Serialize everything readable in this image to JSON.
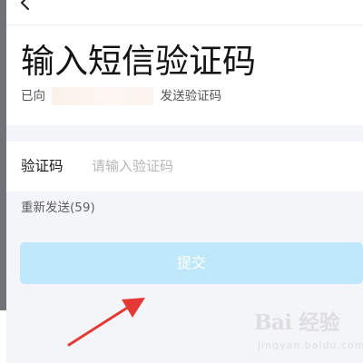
{
  "header": {
    "back_icon": "chevron-left-icon",
    "title": "输入短信验证码",
    "sent_prefix": "已向",
    "sent_suffix": "发送验证码"
  },
  "form": {
    "code_label": "验证码",
    "code_value": "",
    "code_placeholder": "请输入验证码",
    "resend_label": "重新发送(59)",
    "submit_label": "提交"
  },
  "colors": {
    "submit_disabled": "#bfe9fb",
    "annotation_arrow": "#e53935",
    "page_background": "#f4f5f8"
  },
  "watermark": {
    "logo": "Bai 经验",
    "url": "jingyan.baidu.com"
  }
}
